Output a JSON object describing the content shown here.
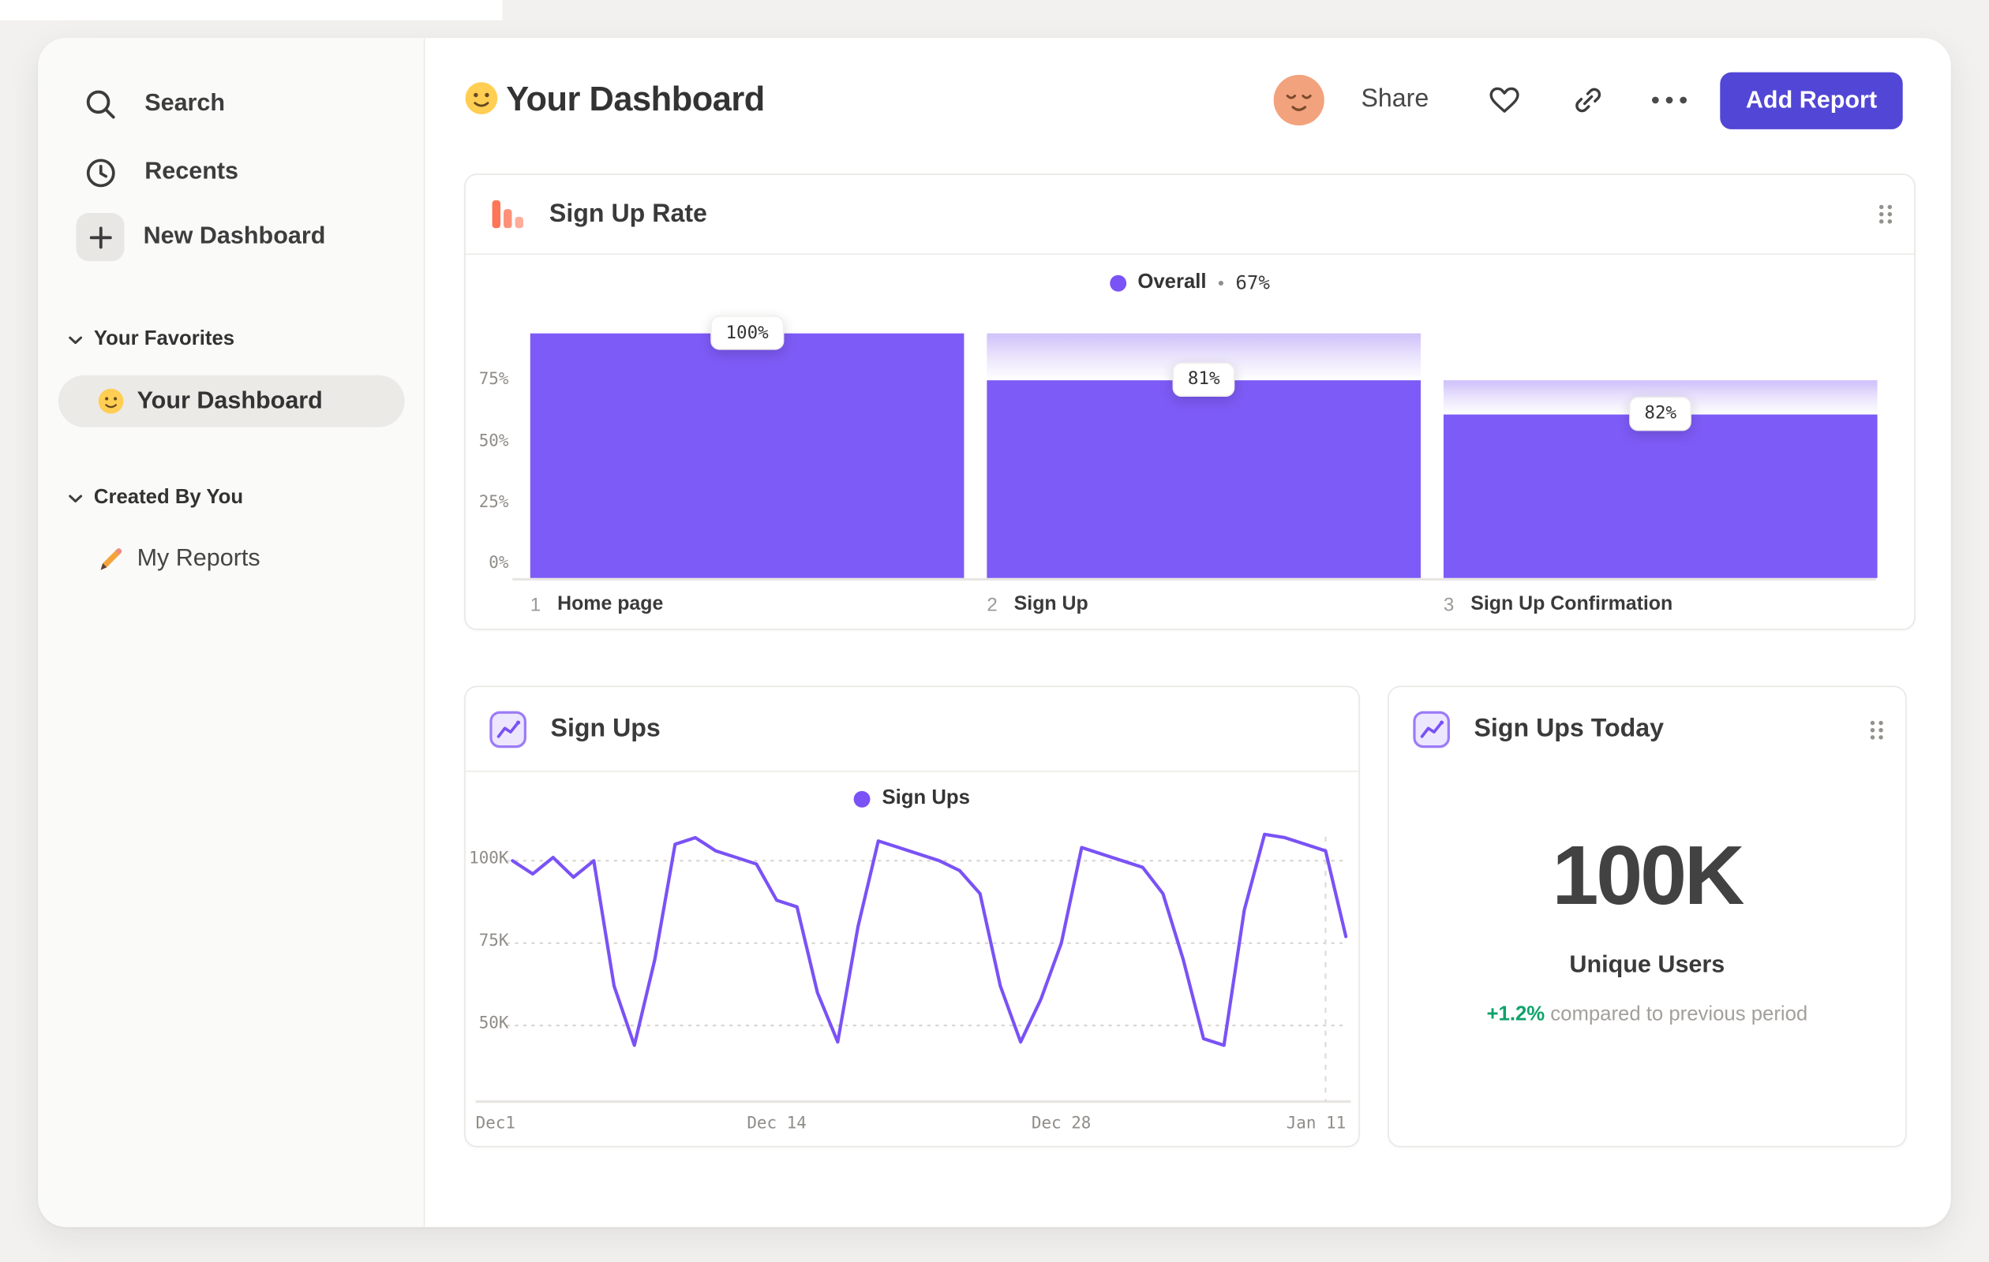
{
  "colors": {
    "accent_purple": "#7a52f5",
    "bar_purple": "#7d5bf6",
    "button_purple": "#5246d6",
    "funnel_orange": "#ff7557",
    "delta_green": "#0ea36a"
  },
  "sidebar": {
    "search": "Search",
    "recents": "Recents",
    "new_dashboard": "New Dashboard",
    "favorites_section": "Your Favorites",
    "favorites_item": "Your Dashboard",
    "created_section": "Created By You",
    "created_item": "My Reports"
  },
  "header": {
    "title": "Your Dashboard",
    "share": "Share",
    "add_report": "Add Report"
  },
  "today_card": {
    "title": "Sign Ups Today",
    "value": "100K",
    "label": "Unique Users",
    "delta": "+1.2%",
    "delta_description": "compared to previous period"
  },
  "chart_data": [
    {
      "type": "bar",
      "subtype": "funnel",
      "title": "Sign Up Rate",
      "legend_label": "Overall",
      "legend_bullet": "•",
      "legend_value": "67%",
      "ylim": [
        0,
        100
      ],
      "y_axis": [
        {
          "label": "75%",
          "value": 75
        },
        {
          "label": "50%",
          "value": 50
        },
        {
          "label": "25%",
          "value": 25
        },
        {
          "label": "0%",
          "value": 0
        }
      ],
      "steps": [
        {
          "num": "1",
          "label": "Home page",
          "conversion_label": "100%",
          "conversion_from_prev_pct": 100,
          "overall_pct": 100,
          "prev_overall_pct": 100
        },
        {
          "num": "2",
          "label": "Sign Up",
          "conversion_label": "81%",
          "conversion_from_prev_pct": 81,
          "overall_pct": 81,
          "prev_overall_pct": 100
        },
        {
          "num": "3",
          "label": "Sign Up Confirmation",
          "conversion_label": "82%",
          "conversion_from_prev_pct": 82,
          "overall_pct": 67,
          "prev_overall_pct": 81
        }
      ]
    },
    {
      "type": "line",
      "title": "Sign Ups",
      "values_unit": "thousands",
      "y_axis": [
        {
          "label": "100K",
          "value": 100
        },
        {
          "label": "75K",
          "value": 75
        },
        {
          "label": "50K",
          "value": 50
        }
      ],
      "x_axis": [
        {
          "label": "Dec1",
          "day": 0
        },
        {
          "label": "Dec 14",
          "day": 13
        },
        {
          "label": "Dec 28",
          "day": 27
        },
        {
          "label": "Jan 11",
          "day": 41
        }
      ],
      "series": [
        {
          "name": "Sign Ups",
          "values": [
            100,
            96,
            101,
            95,
            100,
            62,
            44,
            70,
            105,
            107,
            103,
            101,
            99,
            88,
            86,
            60,
            45,
            80,
            106,
            104,
            102,
            100,
            97,
            90,
            62,
            45,
            58,
            75,
            104,
            102,
            100,
            98,
            90,
            70,
            46,
            44,
            85,
            108,
            107,
            105,
            103,
            77
          ]
        }
      ]
    }
  ]
}
